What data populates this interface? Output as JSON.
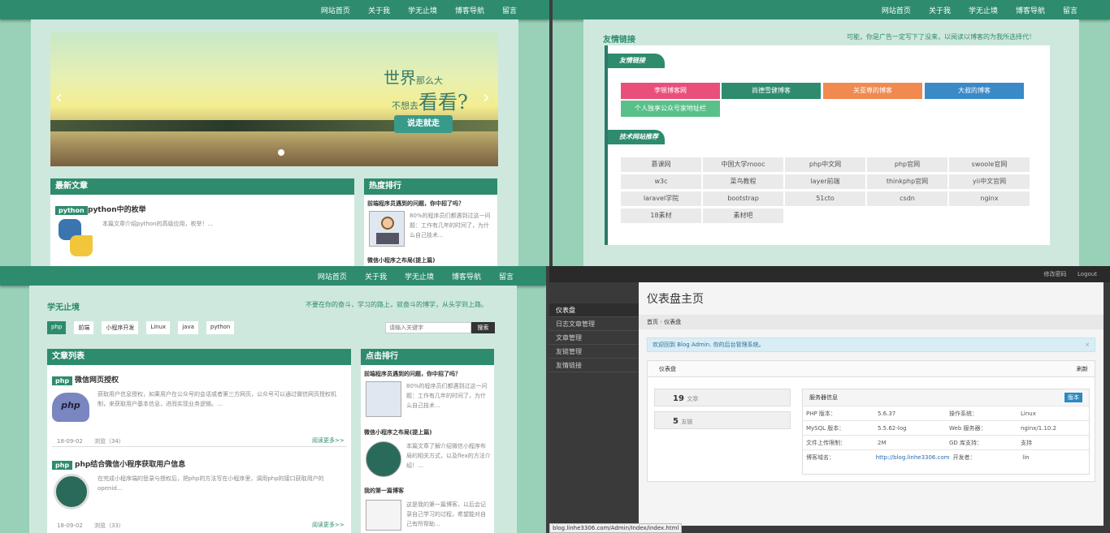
{
  "nav": [
    "网站首页",
    "关于我",
    "学无止境",
    "博客导航",
    "留言"
  ],
  "banner": {
    "title_big": "世界",
    "title_small": "那么大",
    "line2_small": "不想去",
    "line2_big": "看看?",
    "button": "说走就走",
    "prev": "‹",
    "next": "›"
  },
  "latest": {
    "title": "最新文章",
    "tag": "python",
    "post_title": "python中的枚举",
    "post_desc": "本篇文章介绍python的高级应用，枚举！..."
  },
  "hot": {
    "title": "热度排行",
    "item1_title": "前端程序员遇到的问题，你中招了吗？",
    "item1_desc": "80%的程序员们都遇到过这一问题：工作有几年的时间了，为什么自己技术...",
    "item2_title": "微信小程序之布局(提上篇)"
  },
  "friends": {
    "section": "友情链接",
    "notice": "可能，你是广告一定写下了没来，以阅读以博客的为我所选择代！",
    "label1": "友情链接",
    "links": [
      "李顿博客网",
      "尚德雪健博客",
      "关亚尊的博客",
      "大叔的博客",
      "个人独享公众号家地址栏"
    ],
    "label2": "技术网站推荐",
    "tech": [
      "慕课网",
      "中国大学mooc",
      "php中文网",
      "php官网",
      "swoole官网",
      "w3c",
      "菜鸟教程",
      "layer前端",
      "thinkphp官网",
      "yii中文官网",
      "laravel学院",
      "bootstrap",
      "51cto",
      "csdn",
      "nginx",
      "18素材",
      "素材吧"
    ]
  },
  "study": {
    "section": "学无止境",
    "notice": "不要在你的奋斗，学习的路上，就奋斗的博学，从头学到上路。",
    "tags": [
      "php",
      "前端",
      "小程序开发",
      "Linux",
      "java",
      "python"
    ],
    "search_placeholder": "请输入关键字",
    "search_button": "搜索"
  },
  "articles": {
    "title": "文章列表",
    "list": [
      {
        "tag": "php",
        "title": "微信网页授权",
        "desc": "获取用户信息授权，如果用户在公众号的会话或者第三方网页，公众号可以通过微信网页授权机制，来获取用户基本信息，进而实现业务逻辑。...",
        "date": "18-09-02",
        "views": "浏览（34）",
        "more": "阅读更多>>"
      },
      {
        "tag": "php",
        "title": "php结合微信小程序获取用户信息",
        "desc": "在完成小程序端的登录与授权后，把php的方法写在小程序里，调用php的接口获取用户的openid...",
        "date": "18-09-02",
        "views": "浏览（33）",
        "more": "阅读更多>>"
      }
    ]
  },
  "clicks": {
    "title": "点击排行",
    "items": [
      {
        "title": "前端程序员遇到的问题，你中招了吗？",
        "desc": "80%的程序员们都遇到过这一问题：工作有几年的时间了，为什么自己技术..."
      },
      {
        "title": "微信小程序之布局(提上篇)",
        "desc": "本篇文章了解介绍微信小程序布局的相关方式，以及flex的方法介绍！..."
      },
      {
        "title": "我的第一篇博客",
        "desc": "这是我的第一篇博客，以后会记录自己学习的过程，希望能对自己有所帮助..."
      }
    ]
  },
  "admin": {
    "topbar": [
      "修改密码",
      "Logout"
    ],
    "page_title": "仪表盘主页",
    "sidebar": [
      "仪表盘",
      "日志文章管理",
      "文章管理",
      "友链管理",
      "友情链接"
    ],
    "breadcrumb_home": "首页",
    "breadcrumb_current": "仪表盘",
    "alert": "欢迎回到 Blog Admin. 你的后台管理系统。",
    "alert_close": "×",
    "stats_title": "仪表盘",
    "refresh": "刷新",
    "stat1_num": "19",
    "stat1_label": "文章",
    "stat2_num": "5",
    "stat2_label": "友链",
    "sysinfo_title": "服务器信息",
    "sysinfo_badge": "版本",
    "rows": [
      [
        "PHP 版本：",
        "5.6.37",
        "操作系统：",
        "Linux"
      ],
      [
        "MySQL 版本：",
        "5.5.62-log",
        "Web 服务器：",
        "nginx/1.10.2"
      ],
      [
        "文件上传限制：",
        "2M",
        "GD 库支持：",
        "支持"
      ],
      [
        "博客域名：",
        "http://blog.linhe3306.com",
        "开发者：",
        "lin"
      ]
    ],
    "statusbar": "blog.linhe3306.com/Admin/Index/index.html"
  }
}
